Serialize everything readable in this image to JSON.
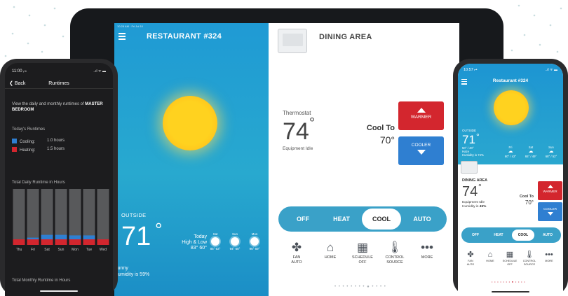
{
  "colors": {
    "sky_blue": "#1f9ad4",
    "mode_bar": "#3aa1c8",
    "warmer_red": "#d3262e",
    "cooler_blue": "#2f7fd1",
    "sun": "#ffd21f",
    "cooling_bar": "#2f7fd1",
    "heating_bar": "#d3262e",
    "runtime_bar": "#58595b"
  },
  "tablet": {
    "menu_icon": "hamburger-icon",
    "location_title": "RESTAURANT #324",
    "outside_label": "OUTSIDE",
    "outside_temp": "71",
    "degree": "°",
    "today_label": "Today",
    "high_low_label": "High & Low",
    "today_high_low": "83° 60°",
    "forecast": [
      {
        "day": "Sat",
        "icon": "sun-icon",
        "temps": "85° 63°"
      },
      {
        "day": "Sun",
        "icon": "sun-icon",
        "temps": "94° 68°"
      },
      {
        "day": "Mon",
        "icon": "sun-icon",
        "temps": "96° 69°"
      }
    ],
    "condition": "Sunny",
    "humidity": "Humidity is 59%",
    "zone_title": "DINING AREA",
    "thermostat_label": "Thermostat",
    "indoor_temp": "74",
    "status": "Equipment Idle",
    "cool_to_label": "Cool To",
    "setpoint": "70°",
    "warmer_label": "WARMER",
    "cooler_label": "COOLER",
    "modes": [
      "OFF",
      "HEAT",
      "COOL",
      "AUTO"
    ],
    "selected_mode": "COOL",
    "actions": [
      {
        "icon": "fan-icon",
        "glyph": "✤",
        "label": "FAN",
        "sub": "AUTO"
      },
      {
        "icon": "home-icon",
        "glyph": "⌂",
        "label": "HOME",
        "sub": ""
      },
      {
        "icon": "calendar-icon",
        "glyph": "▦",
        "label": "SCHEDULE",
        "sub": "OFF"
      },
      {
        "icon": "thermometer-icon",
        "glyph": "🌡",
        "label": "CONTROL",
        "sub": "SOURCE"
      },
      {
        "icon": "more-icon",
        "glyph": "•••",
        "label": "MORE",
        "sub": ""
      }
    ]
  },
  "left_phone": {
    "time": "11:00 ⮣",
    "status_icons": "..ıl ᯤ ▬",
    "back_label": "Back",
    "title": "Runtimes",
    "description_prefix": "View the daily and monthly runtimes of ",
    "description_room": "MASTER BEDROOM",
    "todays_runtimes_label": "Today's Runtimes",
    "cooling_label": "Cooling:",
    "cooling_value": "1.0 hours",
    "heating_label": "Heating:",
    "heating_value": "1.5 hours",
    "daily_chart_title": "Total Daily Runtime in Hours",
    "monthly_chart_title": "Total Monthly Runtime in Hours"
  },
  "right_phone": {
    "time": "10:57 ⮣",
    "status_icons": "..ıl ᯤ ▬",
    "location_title": "Restaurant #324",
    "outside_label": "OUTSIDE",
    "outside_temp": "71",
    "degree": "°",
    "high_low": "50° / 40°",
    "condition": "Haze",
    "humidity": "Humidity is 74%",
    "forecast": [
      {
        "day": "Fri",
        "glyph": "☁",
        "temps": "60° / 42°"
      },
      {
        "day": "Sat",
        "glyph": "☁",
        "temps": "65° / 49°"
      },
      {
        "day": "Sun",
        "glyph": "☁",
        "temps": "68° / 52°"
      }
    ],
    "zone_title": "DINING AREA",
    "indoor_temp": "74",
    "status": "Equipment Idle",
    "humidity_indoor_prefix": "Humidity is ",
    "humidity_indoor_value": "45%",
    "cool_to_label": "Cool To",
    "setpoint": "70°",
    "warmer_label": "WARMER",
    "cooler_label": "COOLER",
    "modes": [
      "OFF",
      "HEAT",
      "COOL",
      "AUTO"
    ],
    "actions": [
      {
        "icon": "fan-icon",
        "glyph": "✤",
        "label": "FAN",
        "sub": "AUTO"
      },
      {
        "icon": "home-icon",
        "glyph": "⌂",
        "label": "HOME",
        "sub": ""
      },
      {
        "icon": "calendar-icon",
        "glyph": "▦",
        "label": "SCHEDULE",
        "sub": "OFF"
      },
      {
        "icon": "thermometer-icon",
        "glyph": "🌡",
        "label": "CONTROL",
        "sub": "SOURCE"
      },
      {
        "icon": "more-icon",
        "glyph": "•••",
        "label": "MORE",
        "sub": ""
      }
    ]
  },
  "chart_data": {
    "type": "bar",
    "title": "Total Daily Runtime in Hours",
    "categories": [
      "Thu",
      "Fri",
      "Sat",
      "Sun",
      "Mon",
      "Tue",
      "Wed"
    ],
    "series": [
      {
        "name": "Heating",
        "values": [
          1.0,
          1.0,
          1.0,
          1.0,
          1.0,
          1.0,
          1.0
        ]
      },
      {
        "name": "Cooling",
        "values": [
          0,
          0.3,
          0.8,
          0.8,
          0.7,
          0.7,
          0
        ]
      }
    ],
    "total_hours": [
      10,
      10,
      10,
      10,
      10,
      10,
      10
    ],
    "stacked": true,
    "ylim": [
      0,
      10
    ],
    "grid": false
  }
}
